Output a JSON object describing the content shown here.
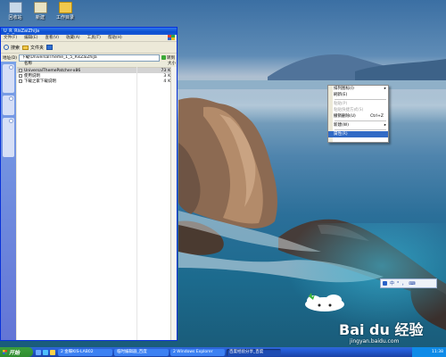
{
  "desktop": {
    "icons": [
      {
        "label": "回收站",
        "icon": "recycle-bin-icon"
      },
      {
        "label": "新建",
        "icon": "new-folder-icon"
      },
      {
        "label": "工作目录",
        "icon": "folder-icon"
      }
    ]
  },
  "explorer": {
    "title": "U_R_RisZaiZhiJa",
    "menu": [
      "文件(F)",
      "编辑(E)",
      "查看(V)",
      "收藏(A)",
      "工具(T)",
      "帮助(H)"
    ],
    "toolbar": {
      "search": "搜索",
      "folders": "文件夹"
    },
    "address": {
      "label": "地址(D)",
      "value": "下载\\UniversalTheme_1_5_RisZaiZhiJa",
      "go": "转到"
    },
    "columns": {
      "name": "名称",
      "size": "大小"
    },
    "files": [
      {
        "name": "UniversalThemePatcher-x86",
        "size": "73",
        "unit": "KB",
        "selected": true
      },
      {
        "name": "使用说明",
        "size": "3",
        "unit": "KB",
        "selected": false
      },
      {
        "name": "下载之家下载说明",
        "size": "4",
        "unit": "KB",
        "selected": false
      }
    ]
  },
  "context_menu": {
    "items": [
      {
        "label": "排列图标(I)",
        "arrow": true,
        "disabled": false,
        "highlight": false
      },
      {
        "label": "刷新(E)",
        "disabled": false,
        "highlight": false
      },
      {
        "sep": true
      },
      {
        "label": "粘贴(P)",
        "disabled": true,
        "highlight": false
      },
      {
        "label": "粘贴快捷方式(S)",
        "disabled": true,
        "highlight": false
      },
      {
        "label": "撤销删除(U)",
        "accel": "Ctrl+Z",
        "disabled": false,
        "highlight": false
      },
      {
        "sep": true
      },
      {
        "label": "新建(W)",
        "arrow": true,
        "disabled": false,
        "highlight": false
      },
      {
        "sep": true
      },
      {
        "label": "属性(R)",
        "disabled": false,
        "highlight": true
      }
    ]
  },
  "ime_bar": {
    "items": [
      "中",
      "°",
      "，",
      "⌨"
    ]
  },
  "watermark": {
    "brand": "Bai du 经验",
    "url": "jingyan.baidu.com"
  },
  "taskbar": {
    "start": "开始",
    "buttons": [
      {
        "label": "2 金蝶KIS-LAB02",
        "active": false
      },
      {
        "label": "临时编辑器_百度",
        "active": false
      },
      {
        "label": "2 Windows Explorer",
        "active": false
      },
      {
        "label": "百度经验分享_百度",
        "active": true
      }
    ],
    "clock": "11:38"
  },
  "colors": {
    "xp_blue": "#0a4fcf",
    "menu_highlight": "#316ac5",
    "start_green": "#2f8c2f",
    "taskbar_blue": "#245dd7"
  }
}
